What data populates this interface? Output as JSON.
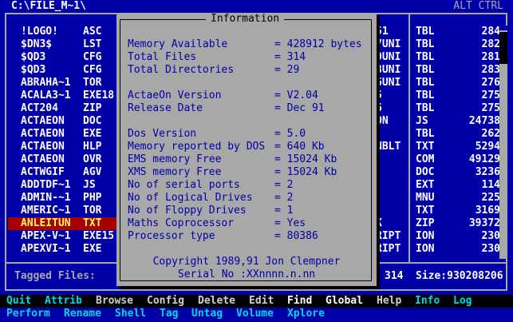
{
  "window": {
    "path": "C:\\FILE_M~1\\",
    "mode": "ALT CTRL"
  },
  "files": [
    {
      "name": "!LOGO!",
      "ext": "ASC",
      "name2": "51",
      "ext2": "TBL",
      "size": "284"
    },
    {
      "name": "$DN3$",
      "ext": "LST",
      "name2": "7UNI",
      "ext2": "TBL",
      "size": "282"
    },
    {
      "name": "$QD3",
      "ext": "CFG",
      "name2": "0UNI",
      "ext2": "TBL",
      "size": "281"
    },
    {
      "name": "$QD3",
      "ext": "CFG",
      "name2": "8UNI",
      "ext2": "TBL",
      "size": "283"
    },
    {
      "name": "ABRAHA~1",
      "ext": "TOR",
      "name2": "6UNI",
      "ext2": "TBL",
      "size": "276"
    },
    {
      "name": "ACALA3~1",
      "ext": "EXE18",
      "name2": "5",
      "ext2": "TBL",
      "size": "275"
    },
    {
      "name": "ACT204",
      "ext": "ZIP",
      "name2": "6",
      "ext2": "TBL",
      "size": "275"
    },
    {
      "name": "ACTAEON",
      "ext": "DOC",
      "name2": "ON",
      "ext2": "JS",
      "size": "24738"
    },
    {
      "name": "ACTAEON",
      "ext": "EXE",
      "name2": "",
      "ext2": "TBL",
      "size": "262"
    },
    {
      "name": "ACTAEON",
      "ext": "HLP",
      "name2": "NBLT",
      "ext2": "TXT",
      "size": "5294"
    },
    {
      "name": "ACTAEON",
      "ext": "OVR",
      "name2": "",
      "ext2": "COM",
      "size": "49129"
    },
    {
      "name": "ACTWGIF",
      "ext": "AGV",
      "name2": "",
      "ext2": "DOC",
      "size": "3236"
    },
    {
      "name": "ADDTDF~1",
      "ext": "JS",
      "name2": "",
      "ext2": "EXT",
      "size": "114"
    },
    {
      "name": "ADMIN-~1",
      "ext": "PHP",
      "name2": "",
      "ext2": "MNU",
      "size": "225"
    },
    {
      "name": "AMERIC~1",
      "ext": "TOR",
      "name2": "",
      "ext2": "TXT",
      "size": "3169"
    },
    {
      "name": "ANLEITUN",
      "ext": "TXT",
      "name2": "K",
      "ext2": "ZIP",
      "size": "39372"
    },
    {
      "name": "APEX-V~1",
      "ext": "EXE15",
      "name2": "RIPT",
      "ext2": "ION",
      "size": "230"
    },
    {
      "name": "APEXVI~1",
      "ext": "EXE",
      "name2": "RIPT",
      "ext2": "ION",
      "size": "230"
    }
  ],
  "status": {
    "tagged_label": "Tagged Files:",
    "count": "314",
    "size": "Size:930208206"
  },
  "menu_row1": [
    "Quit",
    "Attrib",
    "Browse",
    "Config",
    "Delete",
    "Edit",
    "Find",
    "Global",
    "Help",
    "Info",
    "Log"
  ],
  "menu_row2": [
    "Perform",
    "Rename",
    "Shell",
    "Tag",
    "Untag",
    "Volume",
    "Xplore"
  ],
  "dialog": {
    "title": "Information",
    "rows": [
      {
        "label": "Memory Available",
        "value": "= 428912 bytes"
      },
      {
        "label": "Total Files",
        "value": "= 314"
      },
      {
        "label": "Total Directories",
        "value": "= 29"
      },
      {
        "label": "ActaeOn Version",
        "value": "= V2.04"
      },
      {
        "label": "Release Date",
        "value": "= Dec 91"
      },
      {
        "label": "Dos Version",
        "value": "= 5.0"
      },
      {
        "label": "Memory reported by DOS",
        "value": "= 640 Kb"
      },
      {
        "label": "EMS memory Free",
        "value": "= 15024 Kb"
      },
      {
        "label": "XMS memory Free",
        "value": "= 15024 Kb"
      },
      {
        "label": "No of serial ports",
        "value": "= 2"
      },
      {
        "label": "No of Logical Drives",
        "value": "= 2"
      },
      {
        "label": "No of Floppy Drives",
        "value": "= 1"
      },
      {
        "label": "Maths Coprocessor",
        "value": "= Yes"
      },
      {
        "label": "Processor type",
        "value": "= 80386"
      }
    ],
    "copyright": "Copyright 1989,91 Jon Clempner",
    "serial": "Serial No :XXnnnn.n.nn"
  },
  "colors": {
    "background": "#0000a8",
    "selected": "#a80000",
    "dialog": "#a8a8a8",
    "menu_hotkey": "#00d8e8"
  }
}
